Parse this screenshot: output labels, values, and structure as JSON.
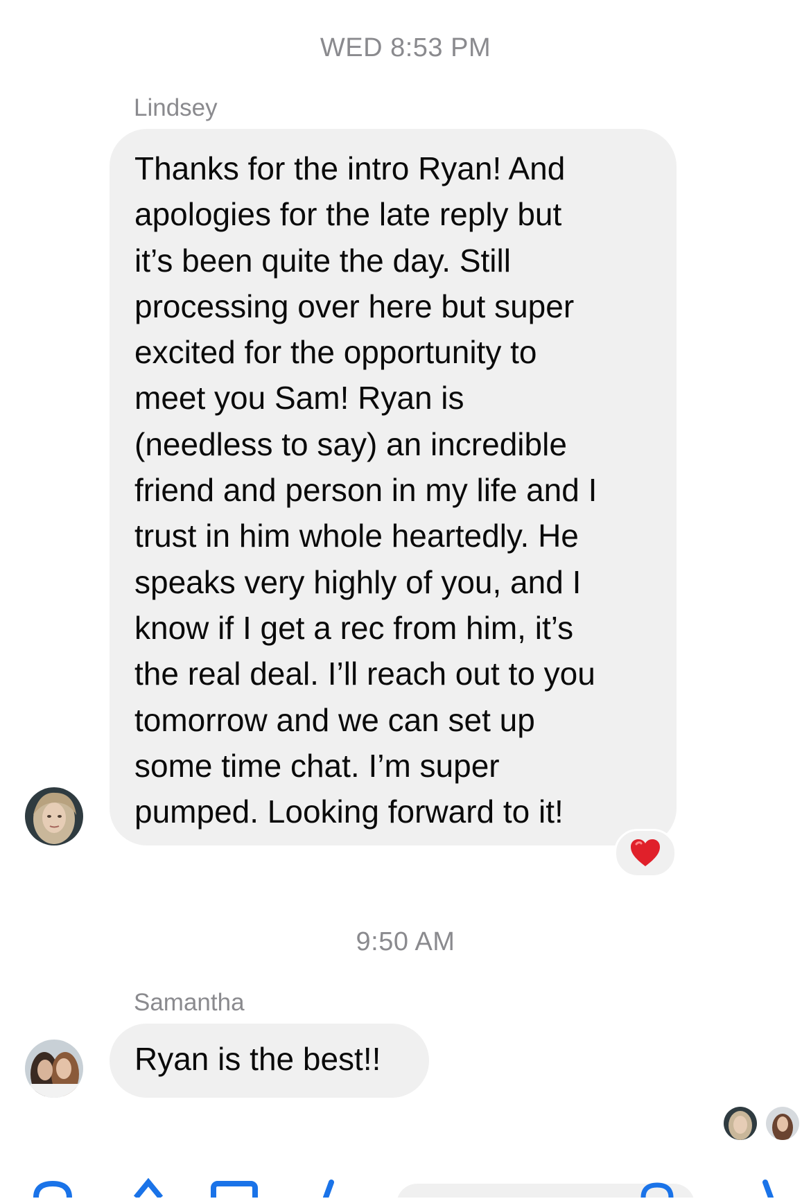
{
  "thread": {
    "timestamp_1": "WED 8:53 PM",
    "timestamp_2": "9:50 AM"
  },
  "messages": [
    {
      "sender": "Lindsey",
      "lines": [
        "Thanks for the intro Ryan! And",
        "apologies for the late reply but",
        "it’s been quite the day. Still",
        "processing over here but super",
        "excited for the opportunity to",
        "meet you Sam! Ryan is",
        "(needless to say) an incredible",
        "friend and person in my life and I",
        "trust in him whole heartedly. He",
        "speaks very highly of you, and I",
        "know if I get a rec from him, it’s",
        "the real deal. I’ll reach out to you",
        "tomorrow and we can set up",
        "some time chat. I’m super",
        "pumped. Looking forward to it!"
      ],
      "reaction": "heart-emoji"
    },
    {
      "sender": "Samantha",
      "lines": [
        "Ryan is the best!!"
      ]
    }
  ],
  "colors": {
    "bubble": "#f0f0f0",
    "meta_text": "#8a8a8e",
    "accent": "#1a73e8",
    "heart": "#e0202a"
  },
  "icons": {
    "reaction": "heart-icon",
    "read_receipts": [
      "read-receipt-avatar-lindsey",
      "read-receipt-avatar-samantha"
    ]
  }
}
